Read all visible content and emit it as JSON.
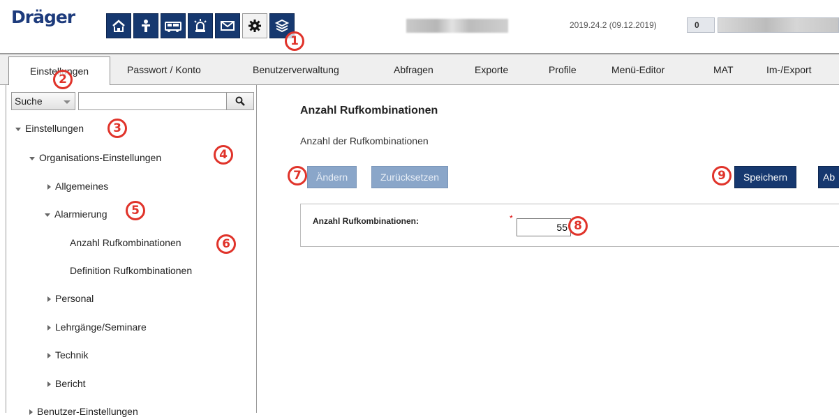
{
  "header": {
    "logo": "Dräger",
    "version": "2019.24.2 (09.12.2019)",
    "badge_count": "0",
    "app_icons": [
      "home-icon",
      "person-icon",
      "vehicle-icon",
      "alarm-icon",
      "mail-icon",
      "settings-gear-icon",
      "layers-icon"
    ],
    "active_icon": "settings-gear-icon",
    "accent": "#16386f"
  },
  "tabs": [
    "Einstellungen",
    "Passwort / Konto",
    "Benutzerverwaltung",
    "Abfragen",
    "Exporte",
    "Profile",
    "Menü-Editor",
    "MAT",
    "Im-/Export"
  ],
  "sidebar": {
    "search_select": "Suche",
    "search_value": "",
    "tree": [
      "Einstellungen",
      "Organisations-Einstellungen",
      "Allgemeines",
      "Alarmierung",
      "Anzahl Rufkombinationen",
      "Definition Rufkombinationen",
      "Personal",
      "Lehrgänge/Seminare",
      "Technik",
      "Bericht",
      "Benutzer-Einstellungen"
    ]
  },
  "main": {
    "title": "Anzahl Rufkombinationen",
    "subtitle": "Anzahl der Rufkombinationen",
    "buttons": {
      "edit": "Ändern",
      "reset": "Zurücksetzen",
      "save": "Speichern",
      "cancel": "Ab"
    },
    "field": {
      "label": "Anzahl Rufkombinationen:",
      "required": "*",
      "value": "55"
    }
  },
  "markers": [
    "1",
    "2",
    "3",
    "4",
    "5",
    "6",
    "7",
    "8",
    "9"
  ]
}
